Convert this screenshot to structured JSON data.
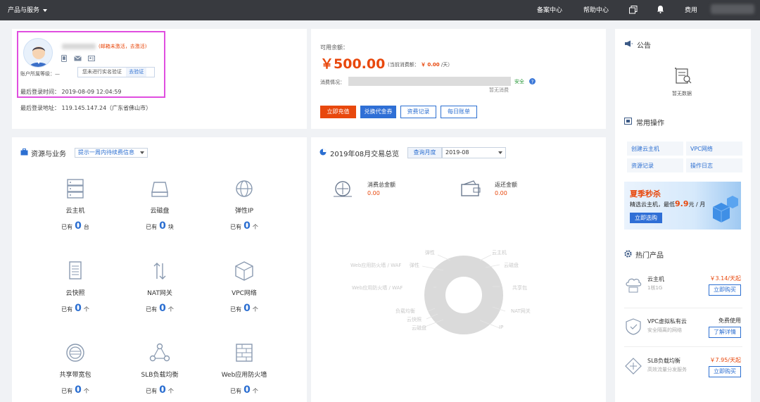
{
  "topbar": {
    "brand": "产品与服务",
    "nav": [
      "备案中心",
      "帮助中心",
      "费用"
    ]
  },
  "account": {
    "mail_notice": "(邮箱未激活，",
    "mail_activate": "去激活)",
    "tooltip_text": "您未进行实名验证",
    "tooltip_link": "去验证",
    "level_label": "账户所属等级：",
    "level_value": "—",
    "last_login_time": "最后登录时间： 2019-08-09 12:04:59",
    "last_login_addr": "最后登录地址： 119.145.147.24（广东省佛山市）"
  },
  "balance": {
    "label": "可用余额：",
    "amount": "￥500.00",
    "current_prefix": "(当前消费额： ",
    "current_value": "￥ 0.00",
    "current_suffix": " /天）",
    "consume_label": "消费情况：",
    "safe": "安全",
    "no_consume": "暂无消费",
    "buttons": [
      "立即充值",
      "兑换代金券",
      "资费记录",
      "每日账单"
    ]
  },
  "resources": {
    "title": "资源与业务",
    "select": "提示一周内待续费信息",
    "items": [
      {
        "name": "云主机",
        "prefix": "已有",
        "count": "0",
        "unit": "台",
        "icon": "server-icon"
      },
      {
        "name": "云磁盘",
        "prefix": "已有",
        "count": "0",
        "unit": "块",
        "icon": "disk-icon"
      },
      {
        "name": "弹性IP",
        "prefix": "已有",
        "count": "0",
        "unit": "个",
        "icon": "globe-icon"
      },
      {
        "name": "云快照",
        "prefix": "已有",
        "count": "0",
        "unit": "个",
        "icon": "snapshot-icon"
      },
      {
        "name": "NAT网关",
        "prefix": "已有",
        "count": "0",
        "unit": "个",
        "icon": "nat-icon"
      },
      {
        "name": "VPC网络",
        "prefix": "已有",
        "count": "0",
        "unit": "个",
        "icon": "vpc-cube-icon"
      },
      {
        "name": "共享带宽包",
        "prefix": "已有",
        "count": "0",
        "unit": "个",
        "icon": "bandwidth-icon"
      },
      {
        "name": "SLB负载均衡",
        "prefix": "已有",
        "count": "0",
        "unit": "个",
        "icon": "slb-icon"
      },
      {
        "name": "Web应用防火墙",
        "prefix": "已有",
        "count": "0",
        "unit": "个",
        "icon": "firewall-icon"
      }
    ]
  },
  "trade": {
    "title": "2019年08月交易总览",
    "tab": "查询月度",
    "month": "2019-08",
    "consume_label": "消费总金额",
    "consume_value": "0.00",
    "refund_label": "返还金额",
    "refund_value": "0.00",
    "donut_labels": [
      "弹性",
      "云主机",
      "云磁盘",
      "Web应用防火墙 / WAF",
      "弹性",
      "Web应用防火墙 / WAF",
      "共享包",
      "NAT网关",
      "负载均衡",
      "云快照",
      "云磁盘",
      "IP"
    ]
  },
  "sidebar": {
    "notice_title": "公告",
    "no_data": "暂无数据",
    "ops_title": "常用操作",
    "ops": [
      "创建云主机",
      "VPC网络",
      "资源记录",
      "操作日志"
    ],
    "banner_title": "夏季秒杀",
    "banner_prefix": "精选云主机，最低",
    "banner_price": "9.9",
    "banner_suffix": "元 / 月",
    "banner_btn": "立即选购",
    "hot_title": "热门产品",
    "products": [
      {
        "title": "云主机",
        "sub": "1核1G",
        "price": "￥3.14/天起",
        "btn": "立即购买"
      },
      {
        "title": "VPC虚拟私有云",
        "sub": "安全隔离的网络",
        "price": "免费使用",
        "btn": "了解详情"
      },
      {
        "title": "SLB负载均衡",
        "sub": "高效流量分发服务",
        "price": "￥7.95/天起",
        "btn": "立即购买"
      }
    ]
  }
}
